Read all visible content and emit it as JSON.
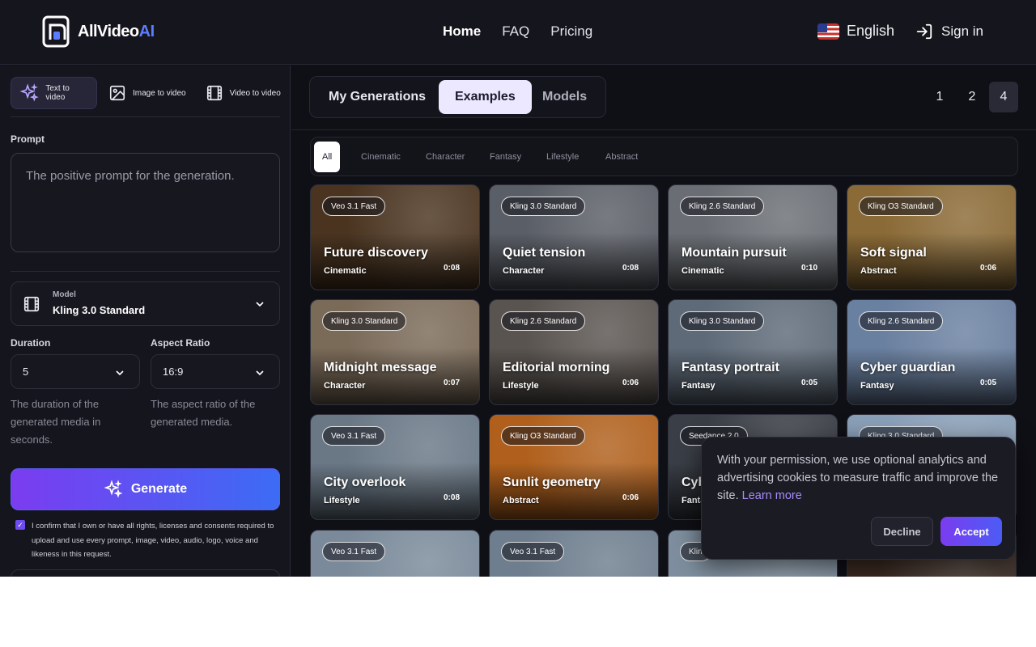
{
  "header": {
    "logo_text": "AllVideo",
    "logo_accent": "AI",
    "nav": [
      {
        "label": "Home",
        "active": true
      },
      {
        "label": "FAQ",
        "active": false
      },
      {
        "label": "Pricing",
        "active": false
      }
    ],
    "language": "English",
    "sign_in": "Sign in"
  },
  "sidebar": {
    "modes": [
      {
        "label": "Text to video",
        "icon": "sparkles-icon",
        "active": true
      },
      {
        "label": "Image to video",
        "icon": "image-icon",
        "active": false
      },
      {
        "label": "Video to video",
        "icon": "film-icon",
        "active": false
      }
    ],
    "prompt_label": "Prompt",
    "prompt_placeholder": "The positive prompt for the generation.",
    "model_label": "Model",
    "model_value": "Kling 3.0 Standard",
    "duration_label": "Duration",
    "duration_value": "5",
    "duration_hint": "The duration of the generated media in seconds.",
    "aspect_label": "Aspect Ratio",
    "aspect_value": "16:9",
    "aspect_hint": "The aspect ratio of the generated media.",
    "generate_label": "Generate",
    "consent_checked": true,
    "consent_text": "I confirm that I own or have all rights, licenses and consents required to upload and use every prompt, image, video, audio, logo, voice and likeness in this request."
  },
  "main": {
    "tabs": [
      {
        "label": "My Generations",
        "active": false
      },
      {
        "label": "Examples",
        "active": true
      },
      {
        "label": "Models",
        "active": false
      }
    ],
    "pagination": [
      {
        "label": "1",
        "active": false
      },
      {
        "label": "2",
        "active": false
      },
      {
        "label": "4",
        "active": true
      }
    ],
    "filters": [
      {
        "label": "All",
        "active": true
      },
      {
        "label": "Cinematic",
        "active": false
      },
      {
        "label": "Character",
        "active": false
      },
      {
        "label": "Fantasy",
        "active": false
      },
      {
        "label": "Lifestyle",
        "active": false
      },
      {
        "label": "Abstract",
        "active": false
      }
    ],
    "cards": [
      {
        "badge": "Veo 3.1 Fast",
        "title": "Future discovery",
        "category": "Cinematic",
        "duration": "0:08",
        "bg": "#4a3420"
      },
      {
        "badge": "Kling 3.0 Standard",
        "title": "Quiet tension",
        "category": "Character",
        "duration": "0:08",
        "bg": "#5a5e66"
      },
      {
        "badge": "Kling 2.6 Standard",
        "title": "Mountain pursuit",
        "category": "Cinematic",
        "duration": "0:10",
        "bg": "#6a6e74"
      },
      {
        "badge": "Kling O3 Standard",
        "title": "Soft signal",
        "category": "Abstract",
        "duration": "0:06",
        "bg": "#8a6a36"
      },
      {
        "badge": "Kling 3.0 Standard",
        "title": "Midnight message",
        "category": "Character",
        "duration": "0:07",
        "bg": "#7a6a58"
      },
      {
        "badge": "Kling 2.6 Standard",
        "title": "Editorial morning",
        "category": "Lifestyle",
        "duration": "0:06",
        "bg": "#5a5450"
      },
      {
        "badge": "Kling 3.0 Standard",
        "title": "Fantasy portrait",
        "category": "Fantasy",
        "duration": "0:05",
        "bg": "#5e6a78"
      },
      {
        "badge": "Kling 2.6 Standard",
        "title": "Cyber guardian",
        "category": "Fantasy",
        "duration": "0:05",
        "bg": "#6a80a0"
      },
      {
        "badge": "Veo 3.1 Fast",
        "title": "City overlook",
        "category": "Lifestyle",
        "duration": "0:08",
        "bg": "#6a7886"
      },
      {
        "badge": "Kling O3 Standard",
        "title": "Sunlit geometry",
        "category": "Abstract",
        "duration": "0:06",
        "bg": "#b0601c"
      },
      {
        "badge": "Seedance 2.0",
        "title": "Cyb",
        "category": "Fanta",
        "duration": "",
        "bg": "#3a3e46"
      },
      {
        "badge": "Kling 3.0 Standard",
        "title": "",
        "category": "",
        "duration": "",
        "bg": "#8aa0b8"
      },
      {
        "badge": "Veo 3.1 Fast",
        "title": "",
        "category": "",
        "duration": "",
        "bg": "#7a8a9a"
      },
      {
        "badge": "Veo 3.1 Fast",
        "title": "",
        "category": "",
        "duration": "",
        "bg": "#6e7e8e"
      },
      {
        "badge": "Klin",
        "title": "",
        "category": "",
        "duration": "",
        "bg": "#7e8e9e"
      },
      {
        "badge": "",
        "title": "",
        "category": "",
        "duration": "",
        "bg": "#3a2a22"
      }
    ]
  },
  "cookie": {
    "text": "With your permission, we use optional analytics and advertising cookies to measure traffic and improve the site.",
    "link": "Learn more",
    "decline": "Decline",
    "accept": "Accept"
  }
}
